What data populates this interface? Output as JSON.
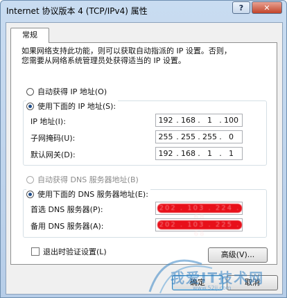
{
  "window": {
    "title": "Internet 协议版本 4 (TCP/IPv4) 属性",
    "help_label": "?",
    "close_label": "✕"
  },
  "tab": {
    "label": "常规"
  },
  "description": {
    "line1": "如果网络支持此功能，则可以获取自动指派的 IP 设置。否则，",
    "line2": "您需要从网络系统管理员处获得适当的 IP 设置。"
  },
  "ip_mode": {
    "auto_label": "自动获得 IP 地址(O)",
    "manual_label": "使用下面的 IP 地址(S):",
    "selected": "manual"
  },
  "ip_fields": [
    {
      "label": "IP 地址(I):",
      "octets": [
        "192",
        "168",
        "1",
        "100"
      ]
    },
    {
      "label": "子网掩码(U):",
      "octets": [
        "255",
        "255",
        "255",
        "0"
      ]
    },
    {
      "label": "默认网关(D):",
      "octets": [
        "192",
        "168",
        "1",
        "1"
      ]
    }
  ],
  "dns_mode": {
    "auto_label": "自动获得 DNS 服务器地址(B)",
    "manual_label": "使用下面的 DNS 服务器地址(E):",
    "selected": "manual"
  },
  "dns_fields": [
    {
      "label": "首选 DNS 服务器(P):",
      "redacted_text": "202 . 103 . 224 . 68"
    },
    {
      "label": "备用 DNS 服务器(A):",
      "redacted_text": "202 . 103 . 225 . 68"
    }
  ],
  "validate_checkbox": {
    "label": "退出时验证设置(L)",
    "checked": false
  },
  "buttons": {
    "advanced": "高级(V)...",
    "ok": "确定",
    "cancel": "取消"
  },
  "watermark": {
    "text": "我爱IT技术网",
    "url": "www.52ij.com"
  },
  "colors": {
    "title_gradient_top": "#c9dcf1",
    "close_button": "#c2442a",
    "redaction": "#e8101a",
    "watermark": "#2f7ec2"
  }
}
